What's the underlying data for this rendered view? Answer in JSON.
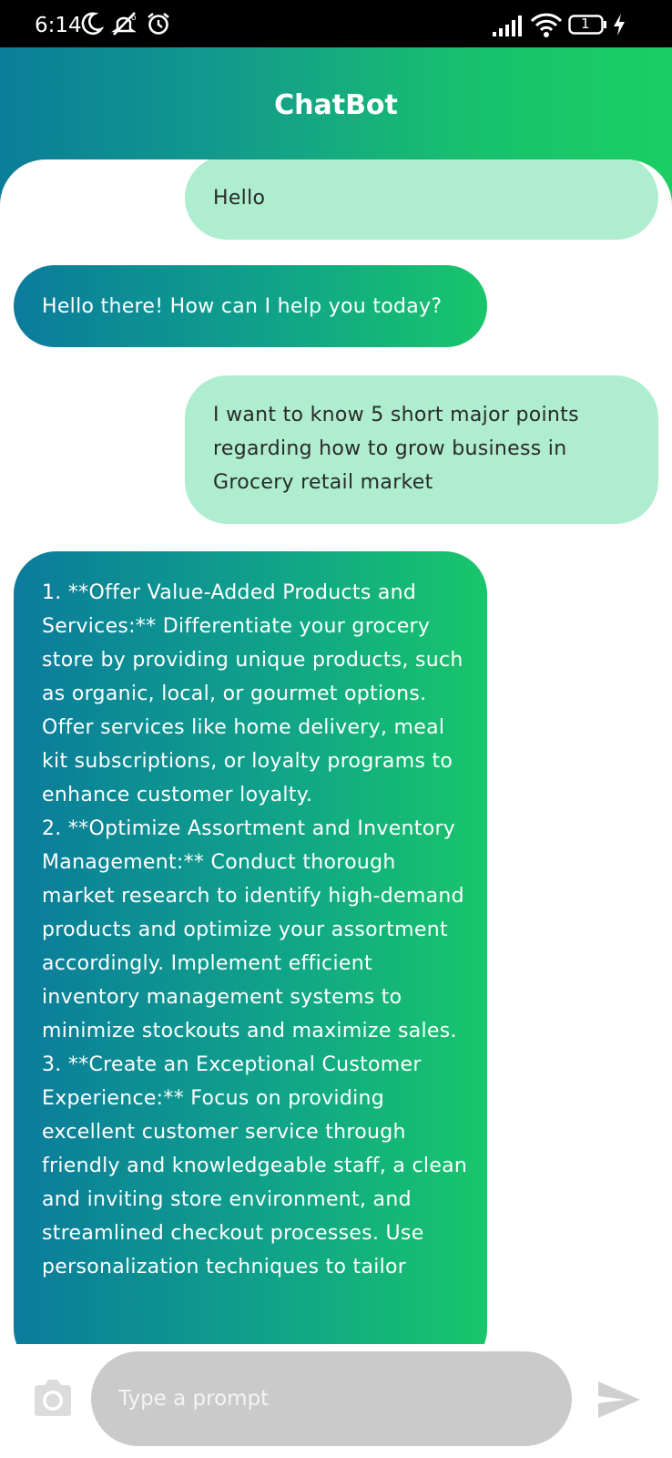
{
  "status_bar": {
    "time": "6:14",
    "left_icons": [
      "moon-icon",
      "mute-icon",
      "alarm-icon"
    ],
    "right_icons": [
      "signal-icon",
      "wifi-icon",
      "battery-icon",
      "charging-icon"
    ],
    "battery_level": "1"
  },
  "header": {
    "title": "ChatBot"
  },
  "colors": {
    "gradient_start": "#0a7d99",
    "gradient_end": "#1bce63",
    "user_bubble": "#aeedcf",
    "input_bg": "#cacaca"
  },
  "messages": [
    {
      "sender": "user",
      "text": "Hello"
    },
    {
      "sender": "bot",
      "text": "Hello there! How can I help you today?"
    },
    {
      "sender": "user",
      "text": "I want to know 5 short major points regarding how to grow business in Grocery retail market"
    },
    {
      "sender": "bot",
      "text": "1. **Offer Value-Added Products and Services:** Differentiate your grocery store by providing unique products, such as organic, local, or gourmet options. Offer services like home delivery, meal kit subscriptions, or loyalty programs to enhance customer loyalty.\n2. **Optimize Assortment and Inventory Management:** Conduct thorough market research to identify high-demand products and optimize your assortment accordingly. Implement efficient inventory management systems to minimize stockouts and maximize sales.\n3. **Create an Exceptional Customer Experience:** Focus on providing excellent customer service through friendly and knowledgeable staff, a clean and inviting store environment, and streamlined checkout processes. Use personalization techniques to tailor"
    }
  ],
  "input": {
    "placeholder": "Type a prompt",
    "value": ""
  }
}
